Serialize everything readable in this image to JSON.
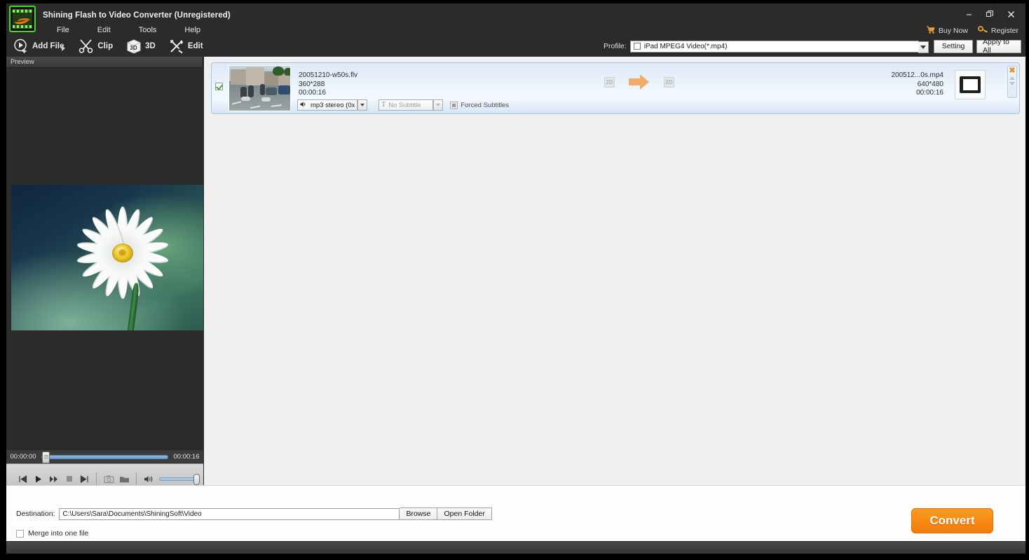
{
  "window": {
    "title": "Shining Flash to Video Converter (Unregistered)",
    "app_icon": "film-strip-icon",
    "minimize": "minimize-icon",
    "restore": "restore-icon",
    "close": "close-icon"
  },
  "menubar": {
    "items": [
      {
        "label": "File"
      },
      {
        "label": "Edit"
      },
      {
        "label": "Tools"
      },
      {
        "label": "Help"
      }
    ]
  },
  "toolbar": {
    "buttons": [
      {
        "label": "Add File",
        "icon": "add-file-icon",
        "has_caret": true
      },
      {
        "label": "Clip",
        "icon": "scissors-icon",
        "has_caret": false
      },
      {
        "label": "3D",
        "icon": "cube-3d-icon",
        "has_caret": false
      },
      {
        "label": "Edit",
        "icon": "tools-wrench-icon",
        "has_caret": false
      }
    ]
  },
  "account": {
    "buy_now": "Buy Now",
    "buy_now_icon": "shopping-cart-icon",
    "register": "Register",
    "register_icon": "key-icon"
  },
  "profile": {
    "label": "Profile:",
    "selected": "iPad MPEG4 Video(*.mp4)",
    "checkbox_checked": false,
    "dropdown_icon": "chevron-down-icon",
    "setting_button": "Setting",
    "apply_all_button": "Apply to All"
  },
  "preview": {
    "header": "Preview",
    "image_description": "white-daisy-flower-on-teal-background",
    "time_current": "00:00:00",
    "time_total": "00:00:16",
    "seek_position_percent": 0,
    "volume_percent": 100,
    "controls": [
      {
        "name": "previous-button",
        "icon": "skip-back-icon"
      },
      {
        "name": "play-button",
        "icon": "play-icon"
      },
      {
        "name": "fast-forward-button",
        "icon": "fast-forward-icon"
      },
      {
        "name": "stop-button",
        "icon": "stop-icon"
      },
      {
        "name": "next-button",
        "icon": "skip-forward-icon"
      },
      {
        "name": "snapshot-button",
        "icon": "camera-icon"
      },
      {
        "name": "open-folder-button",
        "icon": "folder-icon"
      }
    ],
    "volume_icon": "speaker-icon"
  },
  "file_list": {
    "rows": [
      {
        "checked": true,
        "thumbnail": "street-scene-with-segways",
        "source": {
          "filename": "20051210-w50s.flv",
          "resolution": "360*288",
          "duration": "00:00:16"
        },
        "audio_track": "mp3 stereo (0x",
        "subtitle": "No Subtitle",
        "subtitle_icon": "text-t-icon",
        "forced_subtitles_label": "Forced Subtitles",
        "forced_subtitles_checked": false,
        "badge_in": "2D",
        "badge_out": "2D",
        "convert_arrow_icon": "arrow-right-icon",
        "output": {
          "filename": "200512...0s.mp4",
          "resolution": "640*480",
          "duration": "00:00:16"
        },
        "output_thumb_icon": "monitor-icon",
        "delete_icon": "close-x-icon",
        "move_up_icon": "triangle-up-icon",
        "move_down_icon": "triangle-down-icon"
      }
    ]
  },
  "destination": {
    "label": "Destination:",
    "path": "C:\\Users\\Sara\\Documents\\ShiningSoft\\Video",
    "browse_button": "Browse",
    "open_folder_button": "Open Folder",
    "merge_label": "Merge into one file",
    "merge_checked": false
  },
  "action": {
    "convert_button": "Convert",
    "accent_color": "#f47b07"
  },
  "colors": {
    "chrome_dark": "#2b2b2b",
    "panel_light": "#f0f0f0",
    "row_blue": "#dce9f7",
    "accent_orange": "#f47b07",
    "icon_green": "#4cd425"
  }
}
